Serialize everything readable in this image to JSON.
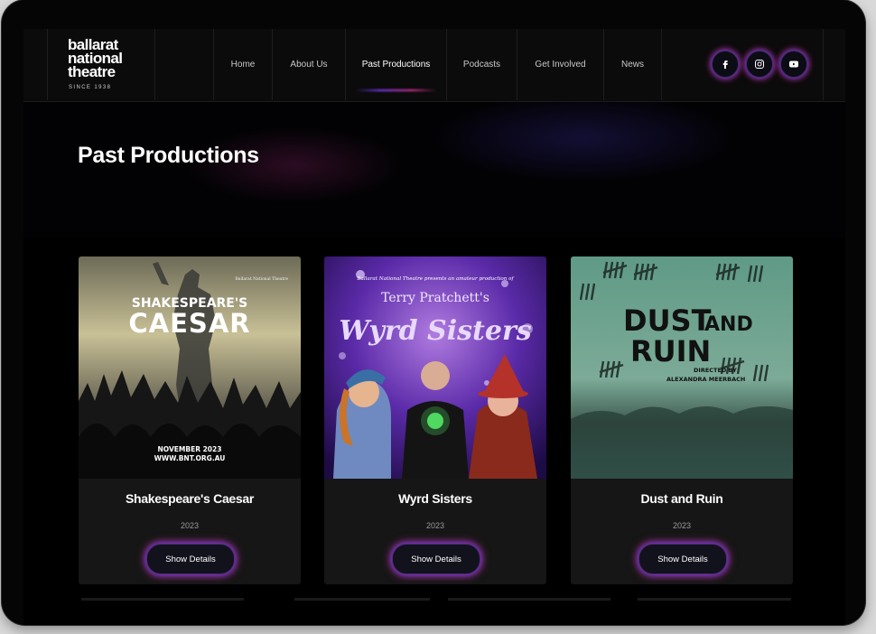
{
  "header": {
    "logo_text": "ballarat\nnational\ntheatre",
    "logo_since": "SINCE 1938",
    "nav": [
      {
        "label": "Home"
      },
      {
        "label": "About Us"
      },
      {
        "label": "Past Productions",
        "active": true
      },
      {
        "label": "Podcasts"
      },
      {
        "label": "Get Involved"
      },
      {
        "label": "News"
      }
    ],
    "social_icons": [
      "facebook-icon",
      "instagram-icon",
      "youtube-icon"
    ]
  },
  "hero": {
    "title": "Past Productions"
  },
  "cards": [
    {
      "title": "Shakespeare's Caesar",
      "year": "2023",
      "button": "Show Details",
      "poster": {
        "line1": "SHAKESPEARE'S",
        "line2": "CAESAR",
        "date": "NOVEMBER 2023",
        "url": "WWW.BNT.ORG.AU",
        "corner": "Ballarat National Theatre"
      }
    },
    {
      "title": "Wyrd Sisters",
      "year": "2023",
      "button": "Show Details",
      "poster": {
        "tagline": "Ballarat National Theatre presents an amateur production of",
        "author": "Terry Pratchett's",
        "name": "Wyrd Sisters"
      }
    },
    {
      "title": "Dust and Ruin",
      "year": "2023",
      "button": "Show Details",
      "poster": {
        "word1": "DUST",
        "word2": "AND",
        "word3": "RUIN",
        "directed": "DIRECTED BY",
        "director": "ALEXANDRA MEERBACH"
      }
    }
  ],
  "colors": {
    "accent_purple": "#7b3cff",
    "accent_pink": "#e0339a",
    "card_bg": "#161616"
  }
}
